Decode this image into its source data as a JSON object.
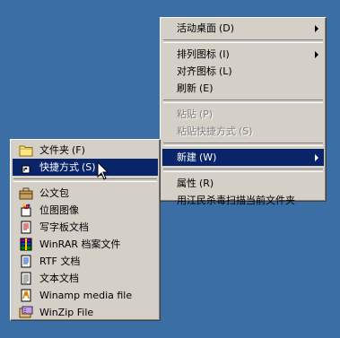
{
  "colors": {
    "desktop": "#3a6ea5",
    "menu_face": "#d4d0c8",
    "highlight": "#0a246a",
    "disabled_text": "#808080"
  },
  "context_menu": {
    "active_desktop": {
      "label": "活动桌面",
      "accel": "(D)"
    },
    "arrange_icons": {
      "label": "排列图标",
      "accel": "(I)"
    },
    "line_up_icons": {
      "label": "对齐图标",
      "accel": "(L)"
    },
    "refresh": {
      "label": "刷新",
      "accel": "(E)"
    },
    "paste": {
      "label": "粘贴",
      "accel": "(P)"
    },
    "paste_shortcut": {
      "label": "粘贴快捷方式",
      "accel": "(S)"
    },
    "new": {
      "label": "新建",
      "accel": "(W)"
    },
    "properties": {
      "label": "属性",
      "accel": "(R)"
    },
    "antivirus_scan": {
      "label": "用江民杀毒扫描当前文件夹"
    }
  },
  "new_submenu": {
    "items": [
      {
        "label": "文件夹",
        "accel": "(F)",
        "icon": "folder-icon"
      },
      {
        "label": "快捷方式",
        "accel": "(S)",
        "icon": "shortcut-icon",
        "selected": true
      },
      {
        "label": "公文包",
        "icon": "briefcase-icon"
      },
      {
        "label": "位图图像",
        "icon": "bitmap-icon"
      },
      {
        "label": "写字板文档",
        "icon": "wordpad-doc-icon"
      },
      {
        "label": "WinRAR 档案文件",
        "icon": "winrar-icon"
      },
      {
        "label": "RTF 文档",
        "icon": "rtf-doc-icon"
      },
      {
        "label": "文本文档",
        "icon": "text-doc-icon"
      },
      {
        "label": "Winamp media file",
        "icon": "winamp-icon"
      },
      {
        "label": "WinZip File",
        "icon": "winzip-icon"
      }
    ]
  }
}
